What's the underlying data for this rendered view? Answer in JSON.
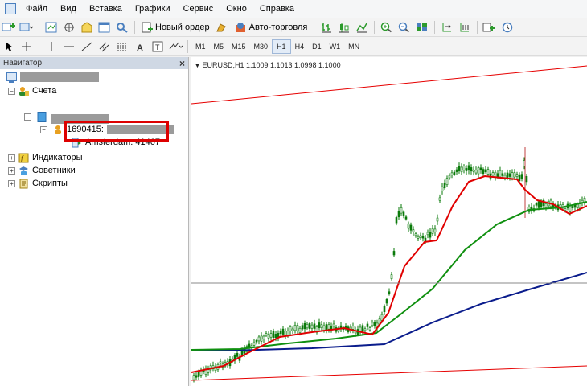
{
  "menu": [
    "Файл",
    "Вид",
    "Вставка",
    "Графики",
    "Сервис",
    "Окно",
    "Справка"
  ],
  "toolbar": {
    "new_order": "Новый ордер",
    "auto_trading": "Авто-торговля",
    "timeframes": [
      "M1",
      "M5",
      "M15",
      "M30",
      "H1",
      "H4",
      "D1",
      "W1",
      "MN"
    ],
    "active_timeframe": "H1"
  },
  "navigator": {
    "title": "Навигатор",
    "close": "×",
    "accounts_label": "Счета",
    "account_number": "1690415:",
    "server": "Amsterdam: 41467",
    "indicators": "Индикаторы",
    "advisors": "Советники",
    "scripts": "Скрипты"
  },
  "chart": {
    "header": "EURUSD,H1  1.1009 1.1013 1.0998 1.1000"
  },
  "colors": {
    "highlight": "#dd0000",
    "ma_fast": "#e00000",
    "ma_mid": "#109010",
    "ma_slow": "#0a1c8c",
    "channel": "#e60000",
    "candle": "#0a7a0a"
  }
}
